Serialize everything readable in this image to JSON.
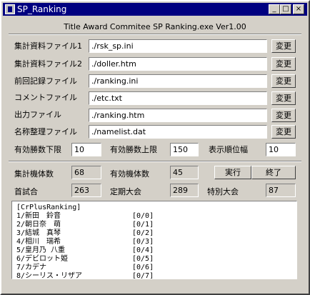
{
  "window": {
    "title": "SP_Ranking",
    "minimize": "_",
    "maximize": "□",
    "close": "×"
  },
  "heading": "Title Award Commitee SP Ranking.exe Ver1.00",
  "files": [
    {
      "label": "集計資料ファイル1",
      "value": "./rsk_sp.ini",
      "button": "変更"
    },
    {
      "label": "集計資料ファイル2",
      "value": "./doller.htm",
      "button": "変更"
    },
    {
      "label": "前回記録ファイル",
      "value": "./ranking.ini",
      "button": "変更"
    },
    {
      "label": "コメントファイル",
      "value": "./etc.txt",
      "button": "変更"
    },
    {
      "label": "出力ファイル",
      "value": "./ranking.htm",
      "button": "変更"
    },
    {
      "label": "名称整理ファイル",
      "value": "./namelist.dat",
      "button": "変更"
    }
  ],
  "limits": {
    "min_label": "有効勝数下限",
    "min_value": "10",
    "max_label": "有効勝数上限",
    "max_value": "150",
    "width_label": "表示順位幅",
    "width_value": "10"
  },
  "stats": {
    "total_label": "集計機体数",
    "total_value": "68",
    "valid_label": "有効機体数",
    "valid_value": "45",
    "first_label": "首試合",
    "first_value": "263",
    "regular_label": "定期大会",
    "regular_value": "289",
    "special_label": "特別大会",
    "special_value": "87"
  },
  "actions": {
    "run": "実行",
    "exit": "終了"
  },
  "ranking": {
    "header": "[CrPlusRanking]",
    "rows": [
      {
        "name": "1/新田　鈴音",
        "score": "[0/0]"
      },
      {
        "name": "2/朝日奈　萌",
        "score": "[0/1]"
      },
      {
        "name": "3/結城　真琴",
        "score": "[0/2]"
      },
      {
        "name": "4/相川　瑞希",
        "score": "[0/3]"
      },
      {
        "name": "5/皇月乃 八重",
        "score": "[0/4]"
      },
      {
        "name": "6/デビロット姫",
        "score": "[0/5]"
      },
      {
        "name": "7/カデナ",
        "score": "[0/6]"
      },
      {
        "name": "8/シーリス・リザア",
        "score": "[0/7]"
      }
    ]
  }
}
